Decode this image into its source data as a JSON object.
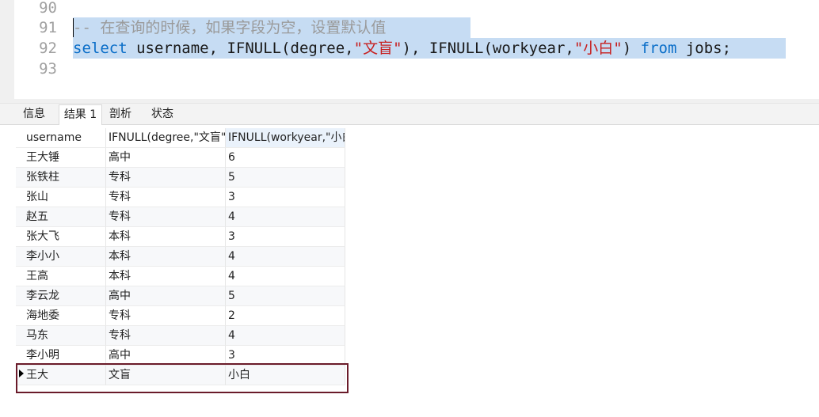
{
  "editor": {
    "lines": [
      {
        "num": "90"
      },
      {
        "num": "91",
        "comment": "-- 在查询的时候，如果字段为空，设置默认值"
      },
      {
        "num": "92",
        "kw_select": "select",
        "part1": " username, IFNULL(degree,",
        "str1": "\"文盲\"",
        "part2": "), IFNULL(workyear,",
        "str2": "\"小白\"",
        "part3": ") ",
        "kw_from": "from",
        "part4": " jobs;"
      },
      {
        "num": "93"
      }
    ]
  },
  "tabs": [
    "信息",
    "结果 1",
    "剖析",
    "状态"
  ],
  "active_tab": "结果 1",
  "grid": {
    "columns": [
      "username",
      "IFNULL(degree,\"文盲\")",
      "IFNULL(workyear,\"小白\")"
    ],
    "rows": [
      [
        "王大锤",
        "高中",
        "6"
      ],
      [
        "张铁柱",
        "专科",
        "5"
      ],
      [
        "张山",
        "专科",
        "3"
      ],
      [
        "赵五",
        "专科",
        "4"
      ],
      [
        "张大飞",
        "本科",
        "3"
      ],
      [
        "李小小",
        "本科",
        "4"
      ],
      [
        "王高",
        "本科",
        "4"
      ],
      [
        "李云龙",
        "高中",
        "5"
      ],
      [
        "海地委",
        "专科",
        "2"
      ],
      [
        "马东",
        "专科",
        "4"
      ],
      [
        "李小明",
        "高中",
        "3"
      ],
      [
        "王大",
        "文盲",
        "小白"
      ]
    ],
    "selected_row": 11
  },
  "colors": {
    "keyword": "#0a6ec8",
    "string": "#c71f1f",
    "comment": "#9a9a9a",
    "selection": "#c6dcf3",
    "row_highlight_border": "#6a1b2a"
  }
}
